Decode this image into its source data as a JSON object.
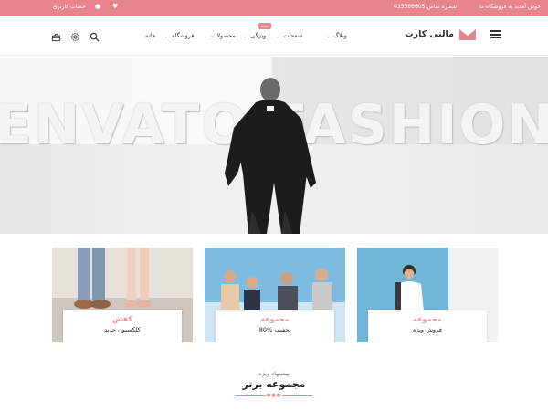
{
  "topbar": {
    "welcome": "خوش آمدید به فروشگاه ما",
    "phone": "شماره تماس:035366605",
    "account": "حساب کاربری",
    "heart_icon": "heart-icon",
    "user_icon": "user-icon",
    "bg_color": "#e8858c"
  },
  "header": {
    "logo_text": "مالتی کارت",
    "nav": [
      {
        "label": "وبلاگ"
      },
      {
        "label": "صفحات"
      },
      {
        "label": "ویژگی",
        "badge": "جدید"
      },
      {
        "label": "محصولات"
      },
      {
        "label": "فروشگاه"
      },
      {
        "label": "خانه"
      }
    ],
    "icons": [
      "search-icon",
      "gear-icon",
      "basket-icon",
      "menu-icon"
    ]
  },
  "hero": {
    "background_text": "ENVATO FASHION"
  },
  "cards": [
    {
      "title": "مجموعه",
      "subtitle": "فروش ویژه"
    },
    {
      "title": "مجموعه",
      "subtitle": "80% تخفیف"
    },
    {
      "title": "کفش",
      "subtitle": "کلکسیون جدید"
    }
  ],
  "featured": {
    "subtitle": "پیشنهاد ویژه",
    "title": "مجموعه برتر"
  },
  "accent_color": "#e8858c"
}
